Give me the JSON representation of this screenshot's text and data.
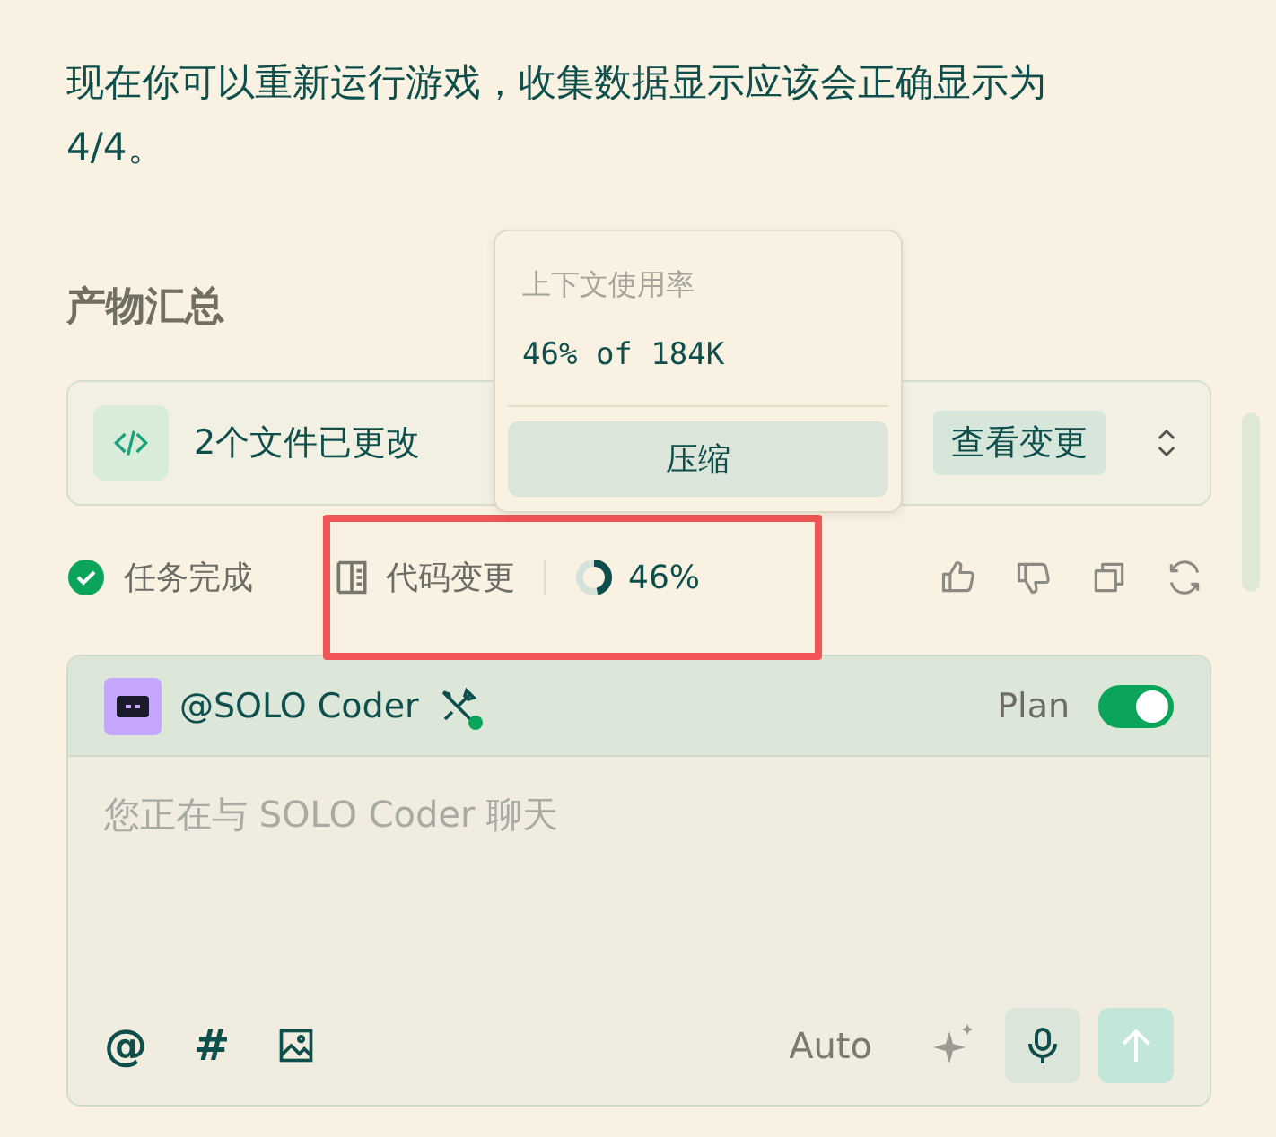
{
  "message": {
    "text": "现在你可以重新运行游戏，收集数据显示应该会正确显示为4/4。"
  },
  "summary": {
    "title": "产物汇总",
    "files_changed": "2个文件已更改",
    "view_button": "查看变更"
  },
  "status": {
    "done_label": "任务完成",
    "changes_label": "代码变更",
    "context_percent": "46%",
    "context_ring": {
      "level": 0.46
    }
  },
  "tooltip": {
    "title": "上下文使用率",
    "detail": "46% of 184K",
    "button": "压缩"
  },
  "composer": {
    "agent": "@SOLO Coder",
    "agent_online": true,
    "plan_label": "Plan",
    "plan_on": true,
    "placeholder": "您正在与 SOLO Coder 聊天",
    "mention": "@",
    "hash": "#",
    "model": "Auto"
  }
}
